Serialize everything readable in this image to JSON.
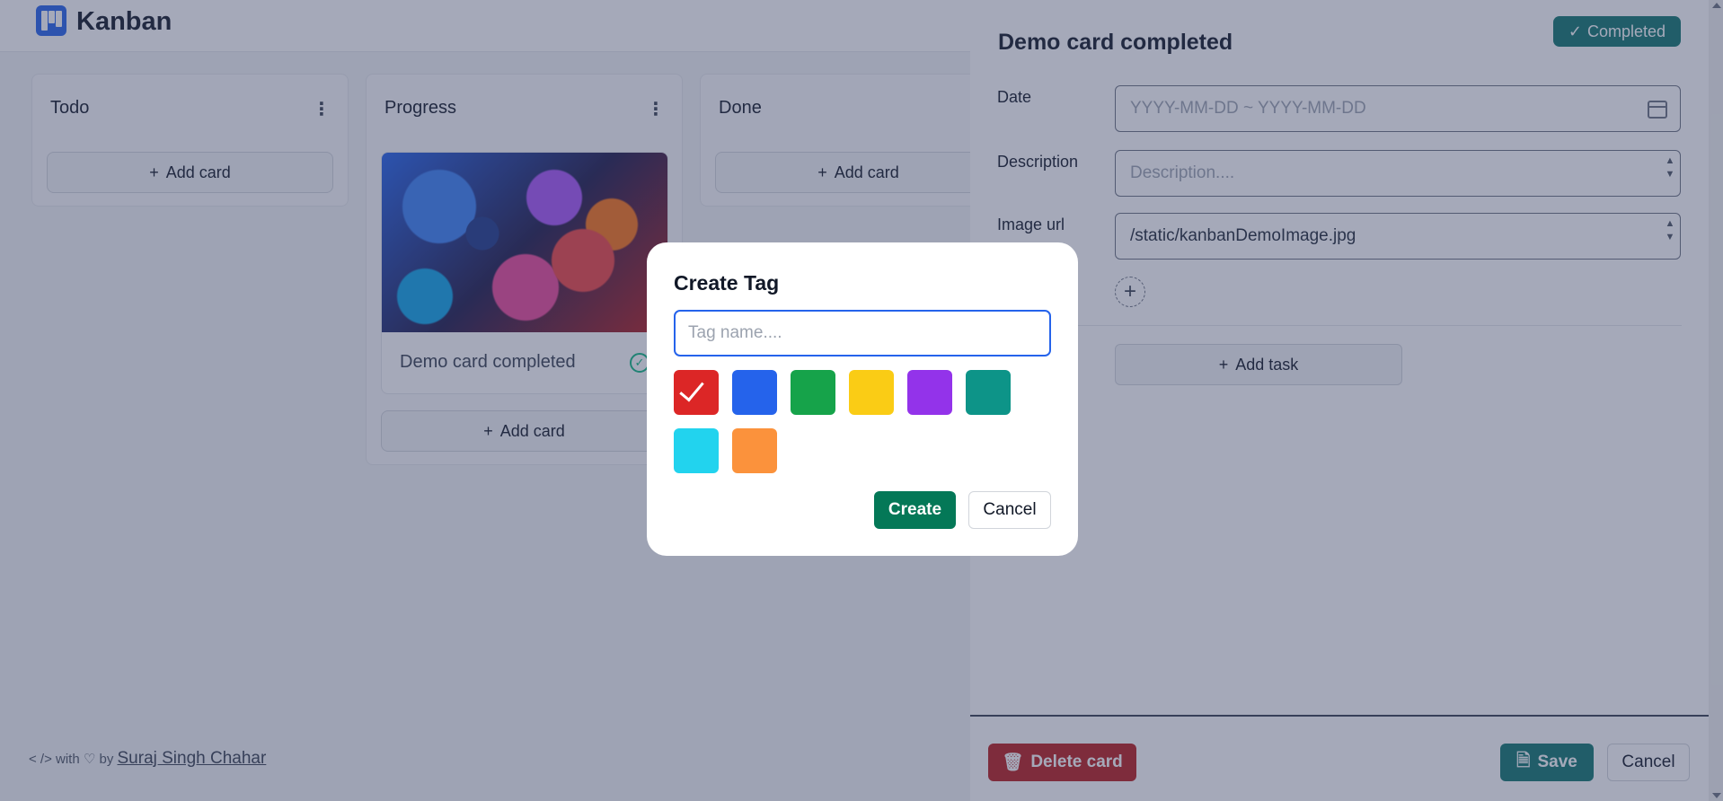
{
  "app": {
    "brand": "Kanban"
  },
  "columns": [
    {
      "title": "Todo",
      "add_label": "Add card"
    },
    {
      "title": "Progress",
      "add_label": "Add card",
      "card": {
        "title": "Demo card completed"
      }
    },
    {
      "title": "Done",
      "add_label": "Add card"
    }
  ],
  "footer": {
    "prefix": "< /> with ♡ by",
    "author": "Suraj Singh Chahar"
  },
  "drawer": {
    "title": "Demo card completed",
    "status_badge": "Completed",
    "date_label": "Date",
    "date_placeholder": "YYYY-MM-DD ~ YYYY-MM-DD",
    "description_label": "Description",
    "description_placeholder": "Description....",
    "image_label": "Image url",
    "image_value": "/static/kanbanDemoImage.jpg",
    "add_task_label": "Add task",
    "delete_label": "Delete card",
    "save_label": "Save",
    "cancel_label": "Cancel"
  },
  "modal": {
    "title": "Create Tag",
    "input_placeholder": "Tag name....",
    "selected_color": "#dc2626",
    "colors": [
      "#dc2626",
      "#2563eb",
      "#16a34a",
      "#facc15",
      "#9333ea",
      "#0d9488",
      "#22d3ee",
      "#fb923c"
    ],
    "create_label": "Create",
    "cancel_label": "Cancel"
  }
}
